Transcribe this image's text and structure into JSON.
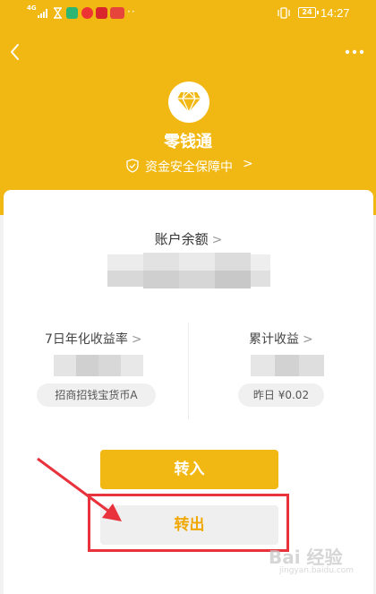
{
  "status_bar": {
    "network": "4G",
    "battery": "24",
    "time": "14:27",
    "overflow": "··"
  },
  "header": {
    "title": "零钱通",
    "safety_text": "资金安全保障中",
    "back_icon": "chevron-left-icon",
    "more_icon": "more-horizontal-icon",
    "logo_icon": "diamond-icon"
  },
  "balance": {
    "label": "账户余额",
    "chevron": ">"
  },
  "stats": {
    "annual_rate_label": "7日年化收益率",
    "fund_name": "招商招钱宝货币A",
    "total_earnings_label": "累计收益",
    "yesterday": "昨日 ¥0.02"
  },
  "actions": {
    "transfer_in": "转入",
    "transfer_out": "转出"
  },
  "colors": {
    "brand": "#f1b813",
    "highlight": "#e8323c"
  },
  "watermark": {
    "text": "Bai 经验",
    "sub": "jingyan.baidu.com"
  }
}
